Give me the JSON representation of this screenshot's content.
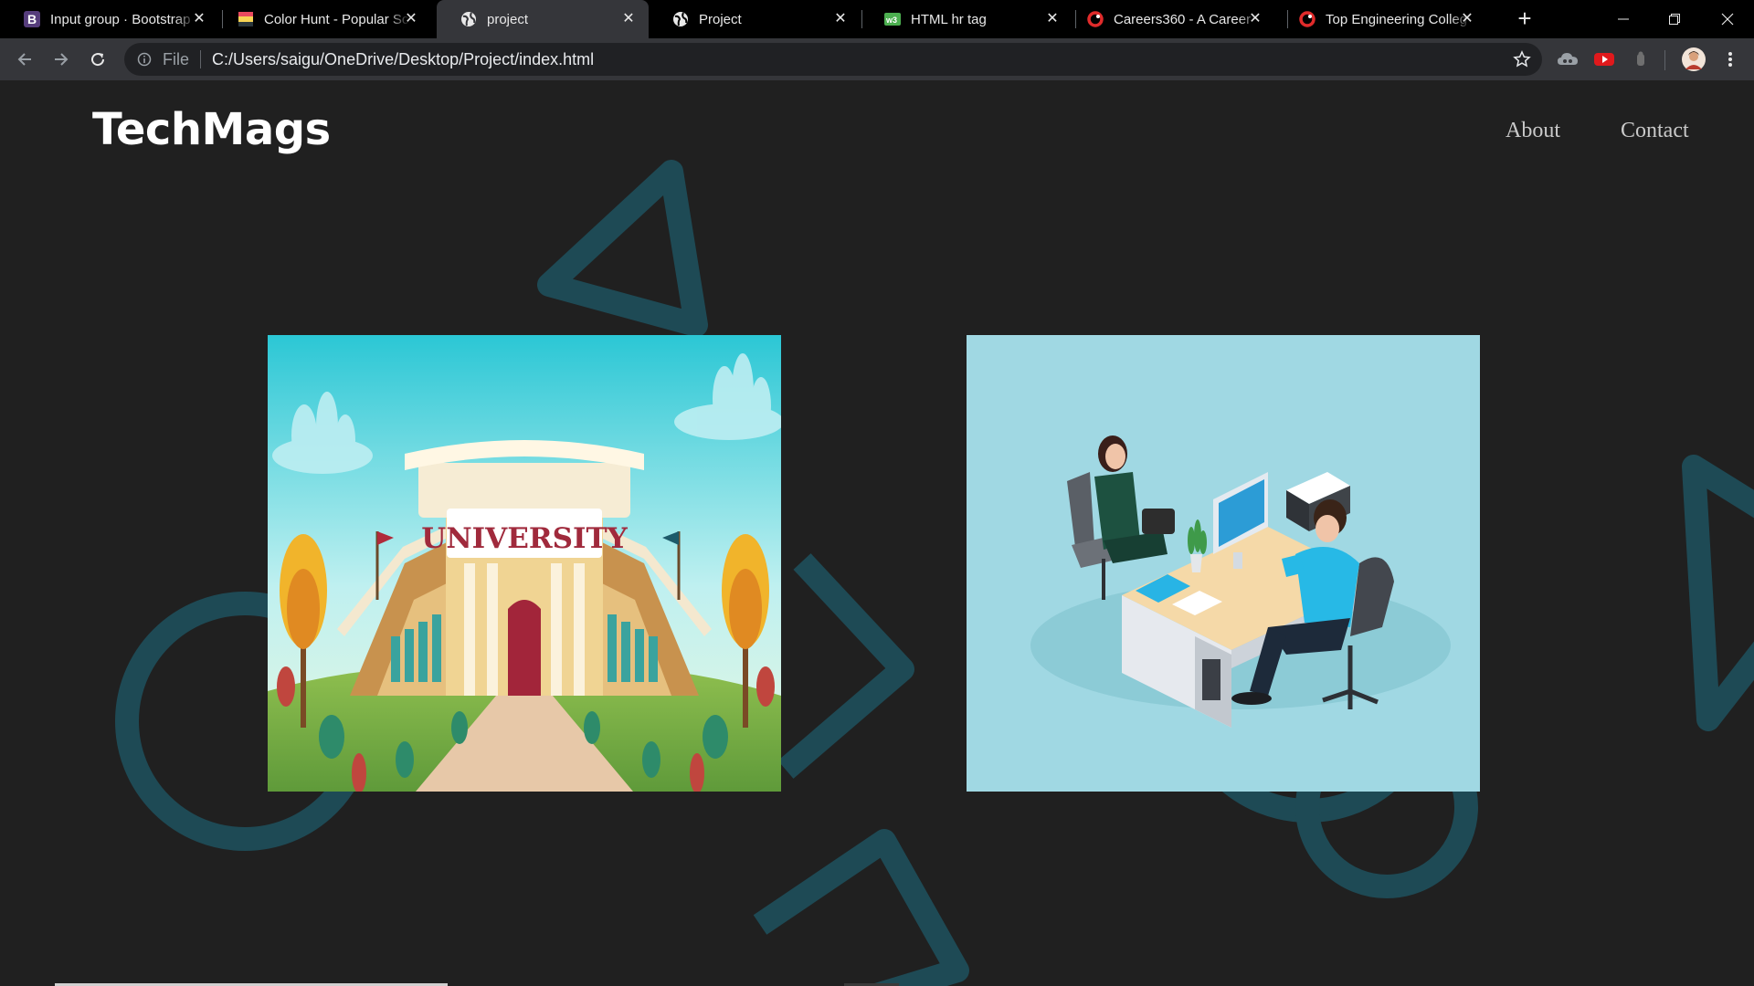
{
  "browser": {
    "tabs": [
      {
        "title": "Input group · Bootstrap",
        "icon": "bootstrap-icon",
        "active": false
      },
      {
        "title": "Color Hunt - Popular Sc",
        "icon": "color-hunt-icon",
        "active": false
      },
      {
        "title": "project",
        "icon": "globe-icon",
        "active": true
      },
      {
        "title": "Project",
        "icon": "globe-icon",
        "active": false
      },
      {
        "title": "HTML hr tag",
        "icon": "w3-icon",
        "active": false
      },
      {
        "title": "Careers360 - A Career",
        "icon": "careers360-icon",
        "active": false
      },
      {
        "title": "Top Engineering Colleg",
        "icon": "careers360-icon",
        "active": false
      }
    ],
    "address_scheme": "File",
    "address_url": "C:/Users/saigu/OneDrive/Desktop/Project/index.html"
  },
  "site": {
    "brand": "TechMags",
    "nav": [
      {
        "label": "About"
      },
      {
        "label": "Contact"
      }
    ],
    "images": [
      {
        "name": "university-illustration",
        "sign_text": "UNIVERSITY"
      },
      {
        "name": "office-desk-illustration"
      }
    ]
  },
  "colors": {
    "page_bg": "#202020",
    "shape_stroke": "#1e4a55",
    "brand_text": "#ffffff",
    "nav_text": "#c9c9c9",
    "office_bg": "#a0d8e3"
  }
}
